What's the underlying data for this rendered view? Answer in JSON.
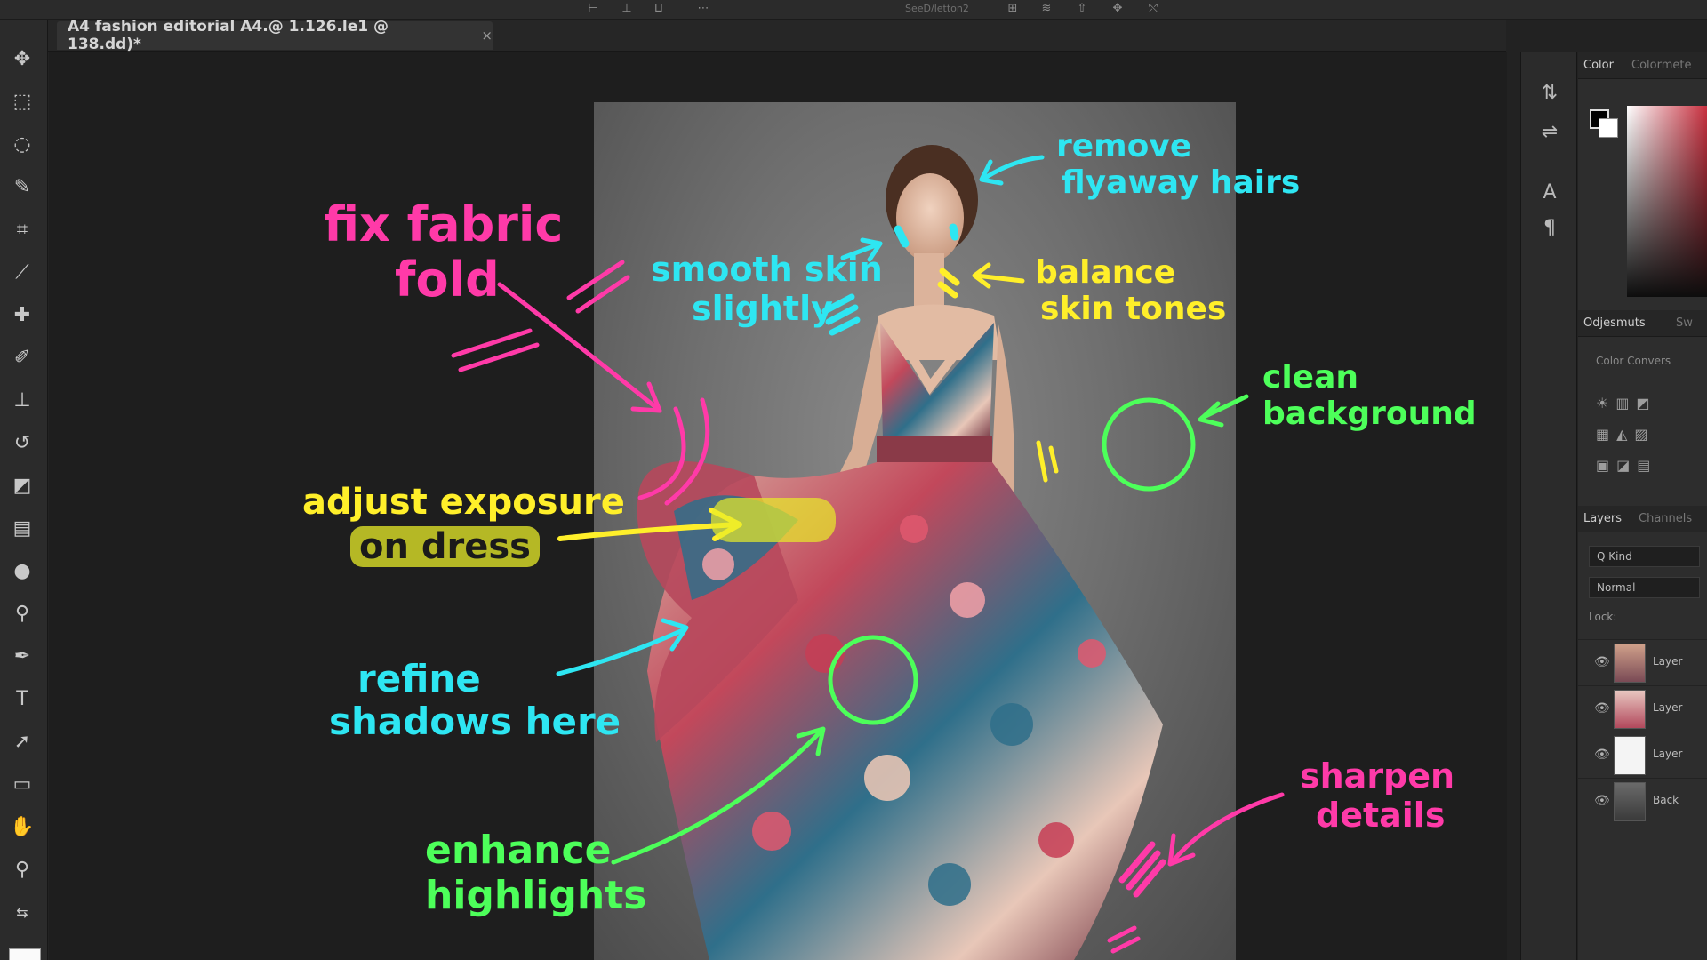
{
  "document_tab": {
    "title": "A4 fashion editorial A4.@ 1.126.le1 @ 138.dd)*",
    "close": "×"
  },
  "optionbar": {
    "field_text": "SeeD/letton2"
  },
  "panels": {
    "color_tab": "Color",
    "color_tab2": "Colormete",
    "adjustments_tab": "Odjesmuts",
    "adjustments_tab2": "Sw",
    "adjustments_sub": "Color Convers",
    "layers_tab": "Layers",
    "channels_tab": "Channels",
    "kind_filter": "Q Kind",
    "blend_mode": "Normal",
    "lock_label": "Lock:",
    "layers": [
      {
        "name": "Layer"
      },
      {
        "name": "Layer"
      },
      {
        "name": "Layer"
      },
      {
        "name": "Back"
      }
    ]
  },
  "annotations": {
    "fix_fabric_line1": "fix fabric",
    "fix_fabric_line2": "fold",
    "remove_line1": "remove",
    "remove_line2": "flyaway hairs",
    "smooth_line1": "smooth skin",
    "smooth_line2": "slightly",
    "balance_line1": "balance",
    "balance_line2": "skin tones",
    "clean_line1": "clean",
    "clean_line2": "background",
    "exposure_line1": "adjust exposure",
    "exposure_line2": "on dress",
    "refine_line1": "refine",
    "refine_line2": "shadows here",
    "enhance_line1": "enhance",
    "enhance_line2": "highlights",
    "sharpen_line1": "sharpen",
    "sharpen_line2": "details"
  },
  "colors": {
    "pink": "#ff3aa8",
    "cyan": "#2ee6f2",
    "yellow": "#ffef2a",
    "green": "#4dff5a"
  },
  "icons": {
    "tools": [
      "move-icon",
      "marquee-icon",
      "lasso-icon",
      "quick-select-icon",
      "crop-icon",
      "eyedropper-icon",
      "healing-icon",
      "brush-icon",
      "stamp-icon",
      "history-brush-icon",
      "eraser-icon",
      "gradient-icon",
      "blur-icon",
      "dodge-icon",
      "pen-icon",
      "type-icon",
      "path-select-icon",
      "rectangle-icon",
      "hand-icon",
      "zoom-icon"
    ]
  }
}
